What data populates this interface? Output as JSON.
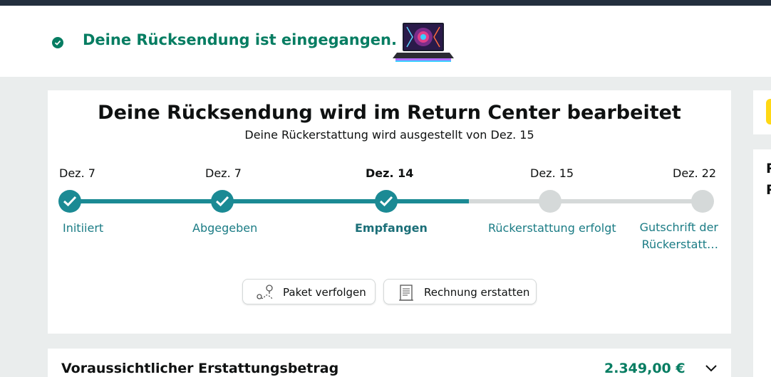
{
  "banner": {
    "message": "Deine Rücksendung ist eingegangen.",
    "status_color": "#067d62"
  },
  "status": {
    "title": "Deine Rücksendung wird im Return Center bearbeitet",
    "subtitle": "Deine Rückerstattung wird ausgestellt von Dez. 15",
    "accent_color": "#1b8a94",
    "steps": [
      {
        "date": "Dez. 7",
        "label": "Initiiert",
        "done": true
      },
      {
        "date": "Dez. 7",
        "label": "Abgegeben",
        "done": true
      },
      {
        "date": "Dez. 14",
        "label": "Empfangen",
        "done": true,
        "current": true
      },
      {
        "date": "Dez. 15",
        "label": "Rückerstattung erfolgt",
        "done": false
      },
      {
        "date": "Dez. 22",
        "label": "Gutschrift der Rückerstatt…",
        "done": false
      }
    ],
    "progress_fraction": 0.625
  },
  "actions": {
    "track_label": "Paket verfolgen",
    "track_icon": "map-pin-route-icon",
    "invoice_label": "Rechnung erstatten",
    "invoice_icon": "document-icon"
  },
  "refund": {
    "label": "Voraussichtlicher Erstattungsbetrag",
    "amount": "2.349,00 €"
  },
  "side": {
    "letters": [
      "R",
      "R"
    ]
  }
}
